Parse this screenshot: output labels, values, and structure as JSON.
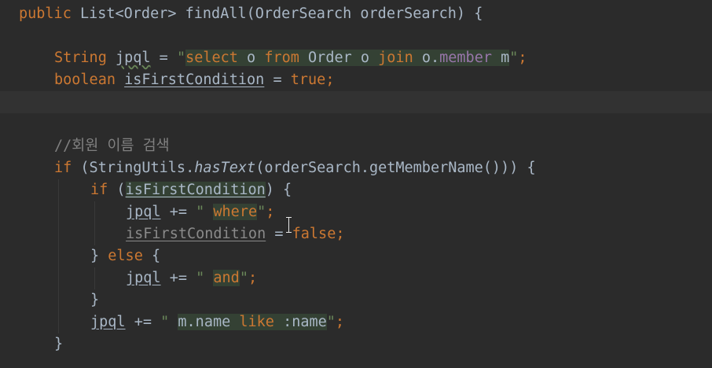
{
  "code": {
    "l1": {
      "kw": "public",
      "type": "List<Order>",
      "method": "findAll",
      "params": "(OrderSearch orderSearch) {"
    },
    "l2": {
      "type": "String",
      "var": "jpql",
      "op": " = ",
      "q1": "\"",
      "s_select": "select",
      "s_o1": " o ",
      "s_from": "from",
      "s_order": " Order o ",
      "s_join": "join",
      "s_o2": " o.",
      "s_member": "member",
      "s_m": " m",
      "q2": "\"",
      "end": ";"
    },
    "l3": {
      "type": "boolean",
      "var": "isFirstCondition",
      "op": " = ",
      "val": "true",
      "end": ";"
    },
    "l5": {
      "comment": "//회원 이름 검색"
    },
    "l6": {
      "kw": "if",
      "pre": " (StringUtils.",
      "fn": "hasText",
      "post": "(orderSearch.getMemberName())) {"
    },
    "l7": {
      "kw": "if",
      "open": " (",
      "var": "isFirstCondition",
      "close": ") {"
    },
    "l8": {
      "var": "jpql",
      "op": " += ",
      "q1": "\" ",
      "s": "where",
      "q2": "\"",
      "end": ";"
    },
    "l9": {
      "var": "isFirstCondition",
      "op": " = ",
      "val": "false",
      "end": ";"
    },
    "l10": {
      "close": "} ",
      "kw": "else",
      "open": " {"
    },
    "l11": {
      "var": "jpql",
      "op": " += ",
      "q1": "\" ",
      "s": "and",
      "q2": "\"",
      "end": ";"
    },
    "l12": {
      "close": "}"
    },
    "l13": {
      "var": "jpql",
      "op": " += ",
      "q1": "\" ",
      "s_mname": "m.name ",
      "s_like": "like",
      "s_name": " :name",
      "q2": "\"",
      "end": ";"
    },
    "l14": {
      "close": "}"
    }
  },
  "colors": {
    "background": "#2b2b2b",
    "keyword": "#cc7832",
    "string": "#6a8759",
    "comment": "#808080",
    "field": "#9876aa",
    "text": "#a9b7c6"
  },
  "icons": {
    "cursor": "text-ibeam-cursor"
  }
}
